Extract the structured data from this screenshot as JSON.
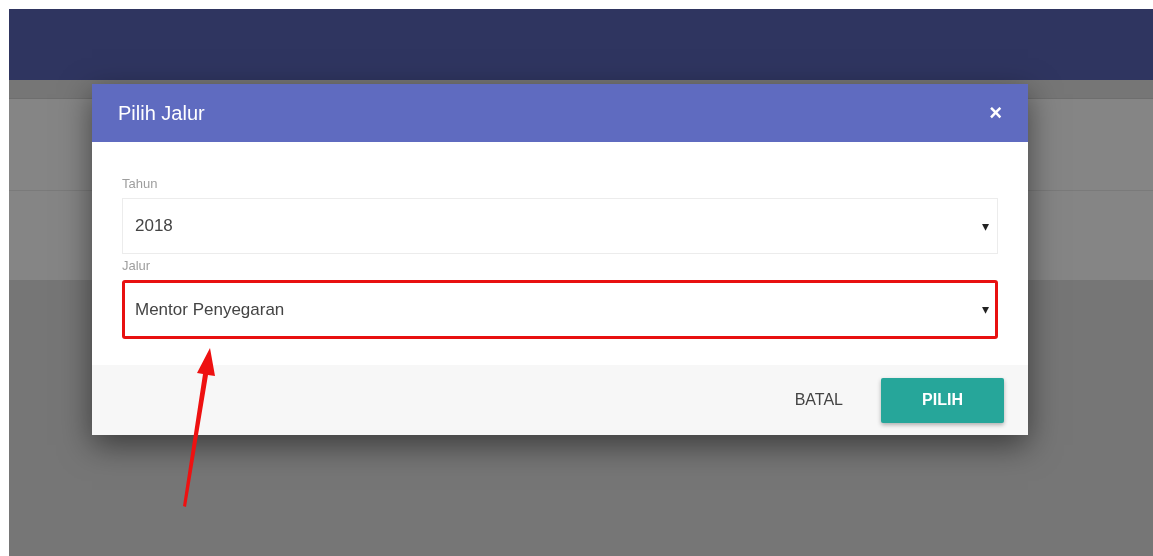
{
  "dialog": {
    "title": "Pilih Jalur",
    "close": "×"
  },
  "fields": [
    {
      "label": "Tahun",
      "value": "2018",
      "caret": "▾",
      "highlighted": false
    },
    {
      "label": "Jalur",
      "value": "Mentor Penyegaran",
      "caret": "▾",
      "highlighted": true
    }
  ],
  "buttons": [
    {
      "label": "BATAL",
      "kind": "flat"
    },
    {
      "label": "PILIH",
      "kind": "raised"
    }
  ]
}
